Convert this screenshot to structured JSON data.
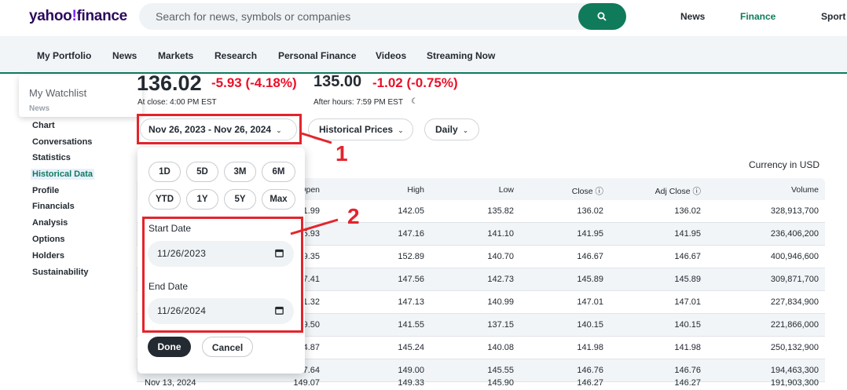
{
  "header": {
    "logo_main": "yahoo",
    "logo_bang": "!",
    "logo_suffix": "finance",
    "search_placeholder": "Search for news, symbols or companies",
    "nav": [
      "News",
      "Finance",
      "Sport"
    ]
  },
  "subnav": [
    "My Portfolio",
    "News",
    "Markets",
    "Research",
    "Personal Finance",
    "Videos",
    "Streaming Now"
  ],
  "sidenav": {
    "watchlist_popup_text": "My Watchlist",
    "overlapped_text": "News",
    "items": [
      "Chart",
      "Conversations",
      "Statistics",
      "Historical Data",
      "Profile",
      "Financials",
      "Analysis",
      "Options",
      "Holders",
      "Sustainability"
    ]
  },
  "quote": {
    "price": "136.02",
    "change": "-5.93 (-4.18%)",
    "close_note": "At close: 4:00 PM EST",
    "after_price": "135.00",
    "after_change": "-1.02 (-0.75%)",
    "after_note": "After hours: 7:59 PM EST"
  },
  "controls": {
    "date_range": "Nov 26, 2023 - Nov 26, 2024",
    "data_type": "Historical Prices",
    "frequency": "Daily",
    "currency": "Currency in USD"
  },
  "popup": {
    "ranges": [
      "1D",
      "5D",
      "3M",
      "6M",
      "YTD",
      "1Y",
      "5Y",
      "Max"
    ],
    "start_label": "Start Date",
    "start_value": "11/26/2023",
    "end_label": "End Date",
    "end_value": "11/26/2024",
    "done": "Done",
    "cancel": "Cancel"
  },
  "annotations": {
    "callout_1": "1",
    "callout_2": "2",
    "color": "#e3242b"
  },
  "table": {
    "headers": [
      "Open",
      "High",
      "Low",
      "Close ⓘ",
      "Adj Close ⓘ",
      "Volume"
    ],
    "rows": [
      [
        "",
        "141.99",
        "142.05",
        "135.82",
        "136.02",
        "136.02",
        "328,913,700"
      ],
      [
        "",
        "145.93",
        "147.16",
        "141.10",
        "141.95",
        "141.95",
        "236,406,200"
      ],
      [
        "",
        "149.35",
        "152.89",
        "140.70",
        "146.67",
        "146.67",
        "400,946,600"
      ],
      [
        "",
        "147.41",
        "147.56",
        "142.73",
        "145.89",
        "145.89",
        "309,871,700"
      ],
      [
        "",
        "141.32",
        "147.13",
        "140.99",
        "147.01",
        "147.01",
        "227,834,900"
      ],
      [
        "",
        "139.50",
        "141.55",
        "137.15",
        "140.15",
        "140.15",
        "221,866,000"
      ],
      [
        "",
        "144.87",
        "145.24",
        "140.08",
        "141.98",
        "141.98",
        "250,132,900"
      ],
      [
        "",
        "147.64",
        "149.00",
        "145.55",
        "146.76",
        "146.76",
        "194,463,300"
      ],
      [
        "Nov 13, 2024",
        "149.07",
        "149.33",
        "145.90",
        "146.27",
        "146.27",
        "191,903,300"
      ]
    ]
  }
}
